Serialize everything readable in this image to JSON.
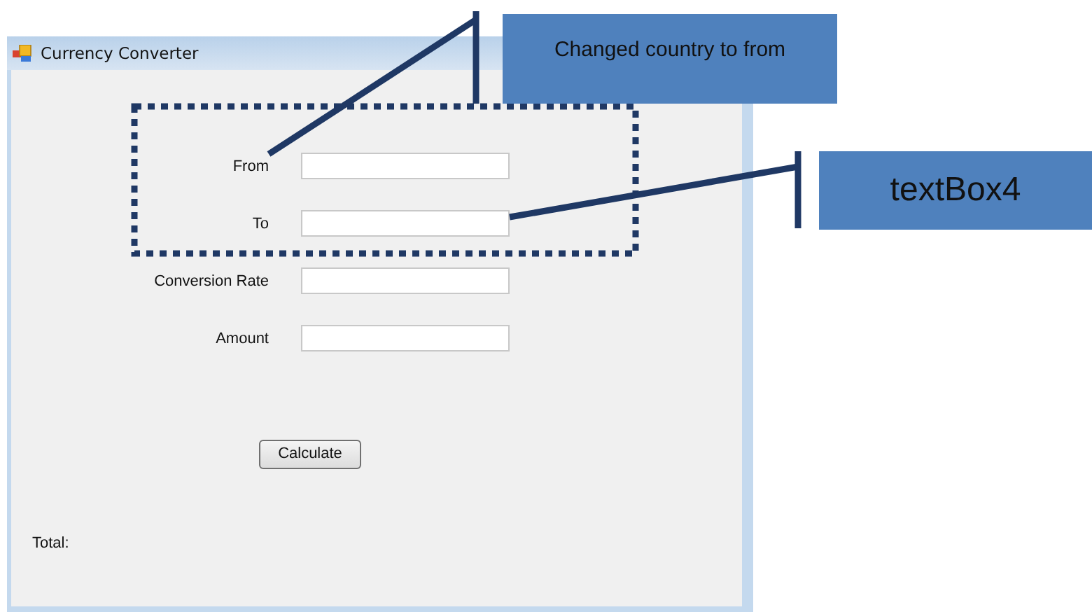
{
  "window": {
    "title": "Currency Converter"
  },
  "fields": [
    {
      "label": "From"
    },
    {
      "label": "To"
    },
    {
      "label": "Conversion Rate"
    },
    {
      "label": "Amount"
    }
  ],
  "buttons": [
    "Calculate"
  ],
  "total_label": "Total:",
  "annotations": [
    {
      "text": "Changed country to from"
    },
    {
      "text": "textBox4"
    }
  ]
}
